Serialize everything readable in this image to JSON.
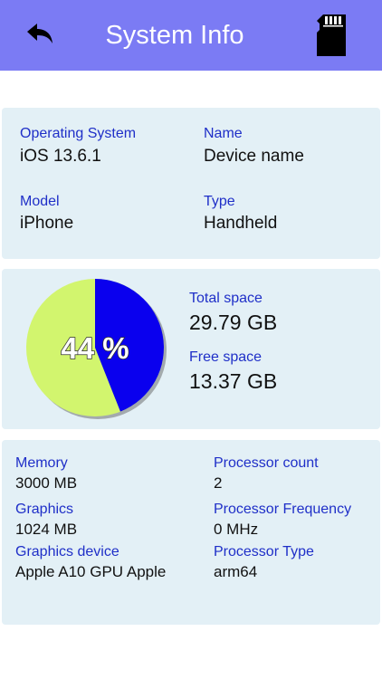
{
  "header": {
    "title": "System Info",
    "back_icon": "back-arrow-icon",
    "sd_icon": "sd-card-icon",
    "background": "#7b7bf4"
  },
  "device": {
    "os_label": "Operating System",
    "os_value": "iOS 13.6.1",
    "name_label": "Name",
    "name_value": "Device name",
    "model_label": "Model",
    "model_value": "iPhone",
    "type_label": "Type",
    "type_value": "Handheld"
  },
  "storage": {
    "percent_text": "44 %",
    "used_fraction": 0.44,
    "total_label": "Total space",
    "total_value": "29.79 GB",
    "free_label": "Free space",
    "free_value": "13.37 GB",
    "used_color": "#0a00ee",
    "free_color": "#d2f56e"
  },
  "hardware": {
    "memory_label": "Memory",
    "memory_value": "3000 MB",
    "cpu_count_label": "Processor count",
    "cpu_count_value": "2",
    "graphics_label": "Graphics",
    "graphics_value": "1024 MB",
    "cpu_freq_label": "Processor Frequency",
    "cpu_freq_value": "0 MHz",
    "gpu_label": "Graphics device",
    "gpu_value": "Apple A10 GPU Apple",
    "cpu_type_label": "Processor Type",
    "cpu_type_value": "arm64"
  }
}
